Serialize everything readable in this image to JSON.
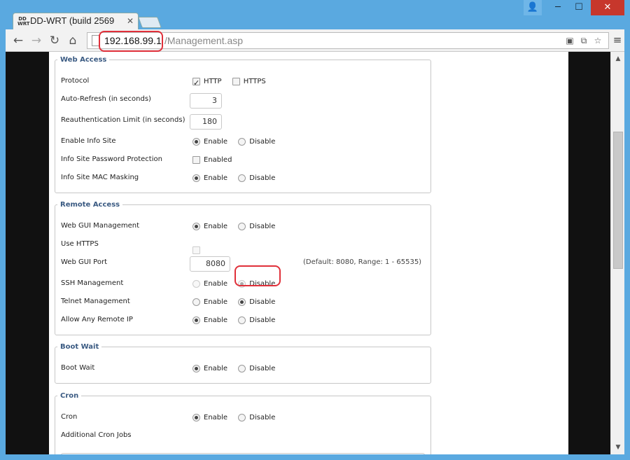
{
  "browser": {
    "tab_title": "DD-WRT (build 2569",
    "favicon_text": "DD WRT",
    "url_host": "192.168.99.1",
    "url_path": "/Management.asp"
  },
  "sections": {
    "web_access": {
      "legend": "Web Access",
      "protocol": {
        "label": "Protocol",
        "http": "HTTP",
        "https": "HTTPS",
        "http_checked": true,
        "https_checked": false
      },
      "auto_refresh": {
        "label": "Auto-Refresh (in seconds)",
        "value": "3"
      },
      "reauth": {
        "label": "Reauthentication Limit (in seconds)",
        "value": "180"
      },
      "info_site": {
        "label": "Enable Info Site",
        "enable": "Enable",
        "disable": "Disable",
        "selected": "enable"
      },
      "info_pw": {
        "label": "Info Site Password Protection",
        "option": "Enabled",
        "checked": false
      },
      "info_mac": {
        "label": "Info Site MAC Masking",
        "enable": "Enable",
        "disable": "Disable",
        "selected": "enable"
      }
    },
    "remote_access": {
      "legend": "Remote Access",
      "web_gui": {
        "label": "Web GUI Management",
        "enable": "Enable",
        "disable": "Disable",
        "selected": "enable"
      },
      "use_https": {
        "label": "Use HTTPS",
        "checked": false
      },
      "web_gui_port": {
        "label": "Web GUI Port",
        "value": "8080",
        "hint": "(Default: 8080, Range: 1 - 65535)"
      },
      "ssh": {
        "label": "SSH Management",
        "enable": "Enable",
        "disable": "Disable",
        "selected": "disable"
      },
      "telnet": {
        "label": "Telnet Management",
        "enable": "Enable",
        "disable": "Disable",
        "selected": "disable"
      },
      "any_remote_ip": {
        "label": "Allow Any Remote IP",
        "enable": "Enable",
        "disable": "Disable",
        "selected": "enable"
      }
    },
    "boot_wait": {
      "legend": "Boot Wait",
      "boot_wait": {
        "label": "Boot Wait",
        "enable": "Enable",
        "disable": "Disable",
        "selected": "enable"
      }
    },
    "cron": {
      "legend": "Cron",
      "cron": {
        "label": "Cron",
        "enable": "Enable",
        "disable": "Disable",
        "selected": "enable"
      },
      "additional": {
        "label": "Additional Cron Jobs"
      }
    }
  },
  "colors": {
    "highlight": "#e0303a",
    "legend": "#3a5a82",
    "window": "#5aa9e0"
  }
}
